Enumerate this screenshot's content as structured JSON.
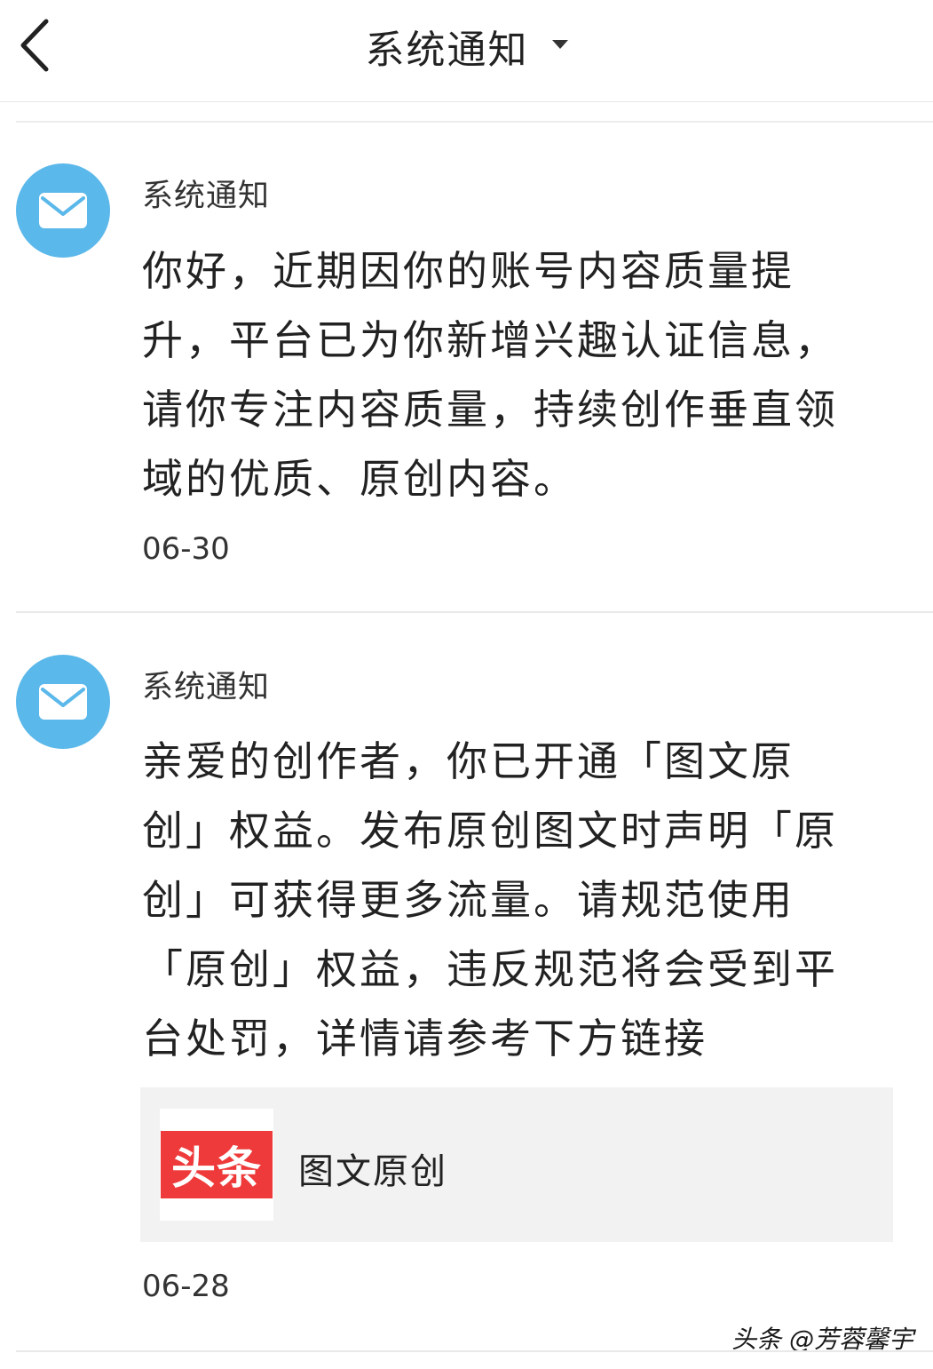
{
  "header": {
    "title": "系统通知",
    "back_icon": "chevron-left-icon",
    "dropdown_icon": "caret-down-icon"
  },
  "notifications": [
    {
      "sender": "系统通知",
      "icon": "envelope-icon",
      "body_lines": [
        "你好，近期因你的账号内容质量提",
        "升，平台已为你新增兴趣认证信息，",
        "请你专注内容质量，持续创作垂直领",
        "域的优质、原创内容。"
      ],
      "date": "06-30"
    },
    {
      "sender": "系统通知",
      "icon": "envelope-icon",
      "body_lines": [
        "亲爱的创作者，你已开通「图文原",
        "创」权益。发布原创图文时声明「原",
        "创」可获得更多流量。请规范使用",
        "「原创」权益，违反规范将会受到平",
        "台处罚，详情请参考下方链接"
      ],
      "link_card": {
        "logo_text": "头条",
        "title": "图文原创"
      },
      "date": "06-28"
    }
  ],
  "watermark": "头条 @芳蓉馨宇",
  "colors": {
    "avatar_bg": "#5bb8ea",
    "logo_bg": "#ee3a3a",
    "card_bg": "#f2f2f2"
  }
}
